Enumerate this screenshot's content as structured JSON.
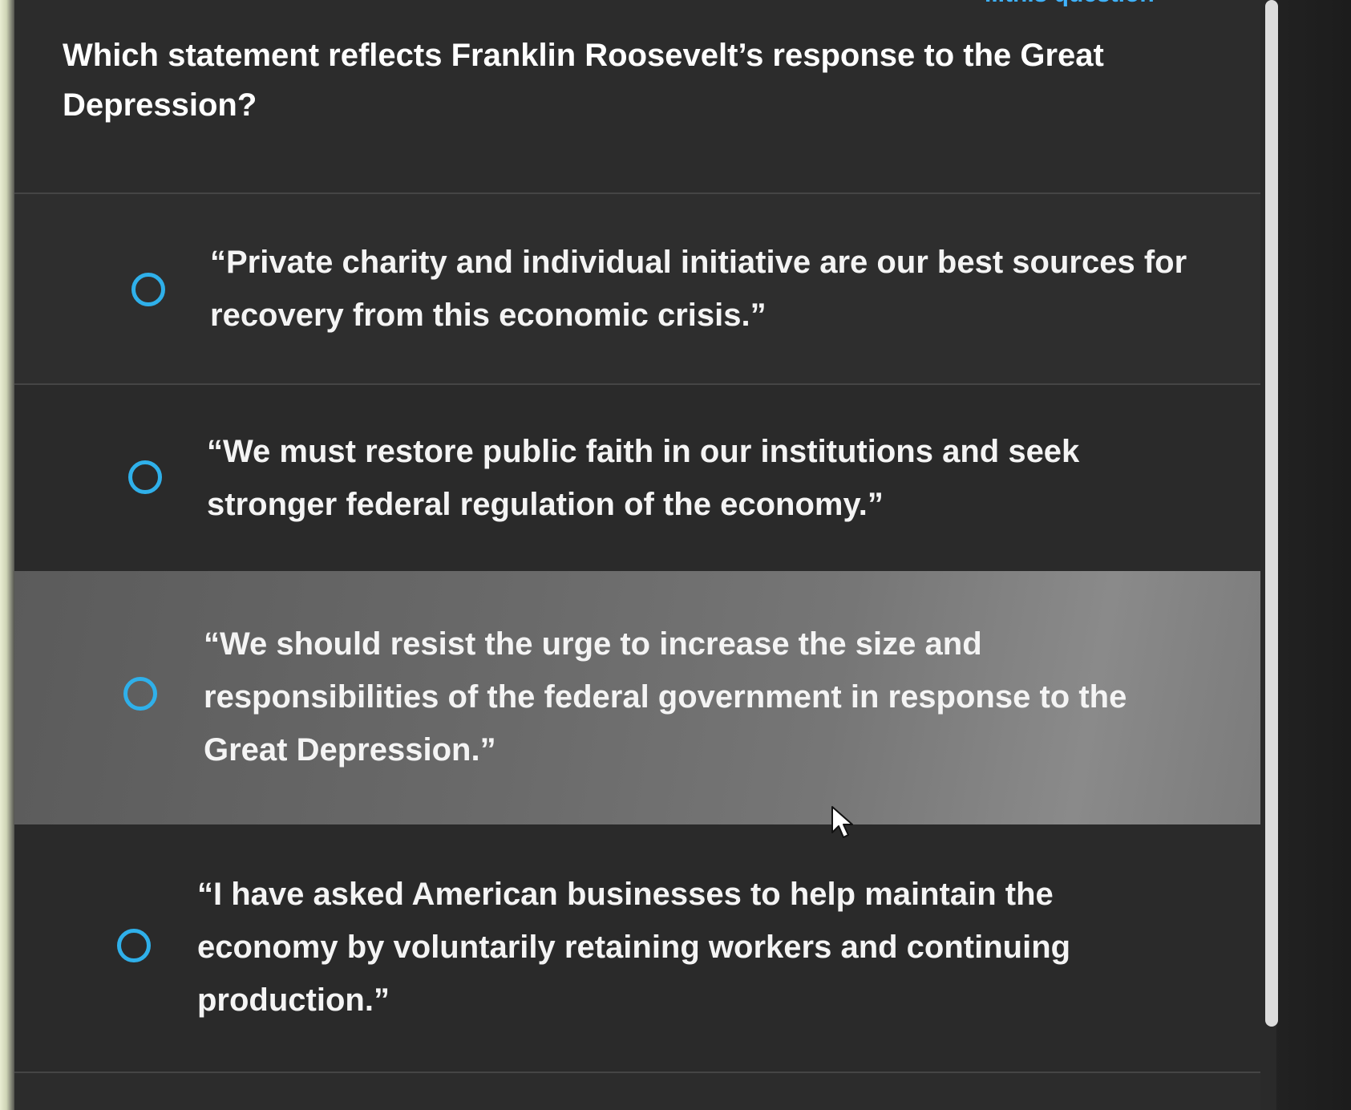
{
  "header": {
    "partial_link": "...this question"
  },
  "question": {
    "text": "Which statement reflects Franklin Roosevelt’s response to the Great Depression?"
  },
  "options": [
    {
      "label": "“Private charity and individual initiative are our best sources for recovery from this economic crisis.”"
    },
    {
      "label": "“We must restore public faith in our institutions and seek stronger federal regulation of the economy.”"
    },
    {
      "label": "“We should resist the urge to increase the size and responsibilities of the federal government in response to the Great Depression.”"
    },
    {
      "label": "“I have asked American businesses to help maintain the economy by voluntarily retaining workers and continuing production.”"
    }
  ],
  "colors": {
    "radio": "#2fb0ea",
    "background": "#2c2c2c",
    "hover_background": "#6e6e6e",
    "text": "#ffffff"
  },
  "icons": {
    "radio": "radio-unselected-icon",
    "cursor": "mouse-pointer-icon"
  }
}
